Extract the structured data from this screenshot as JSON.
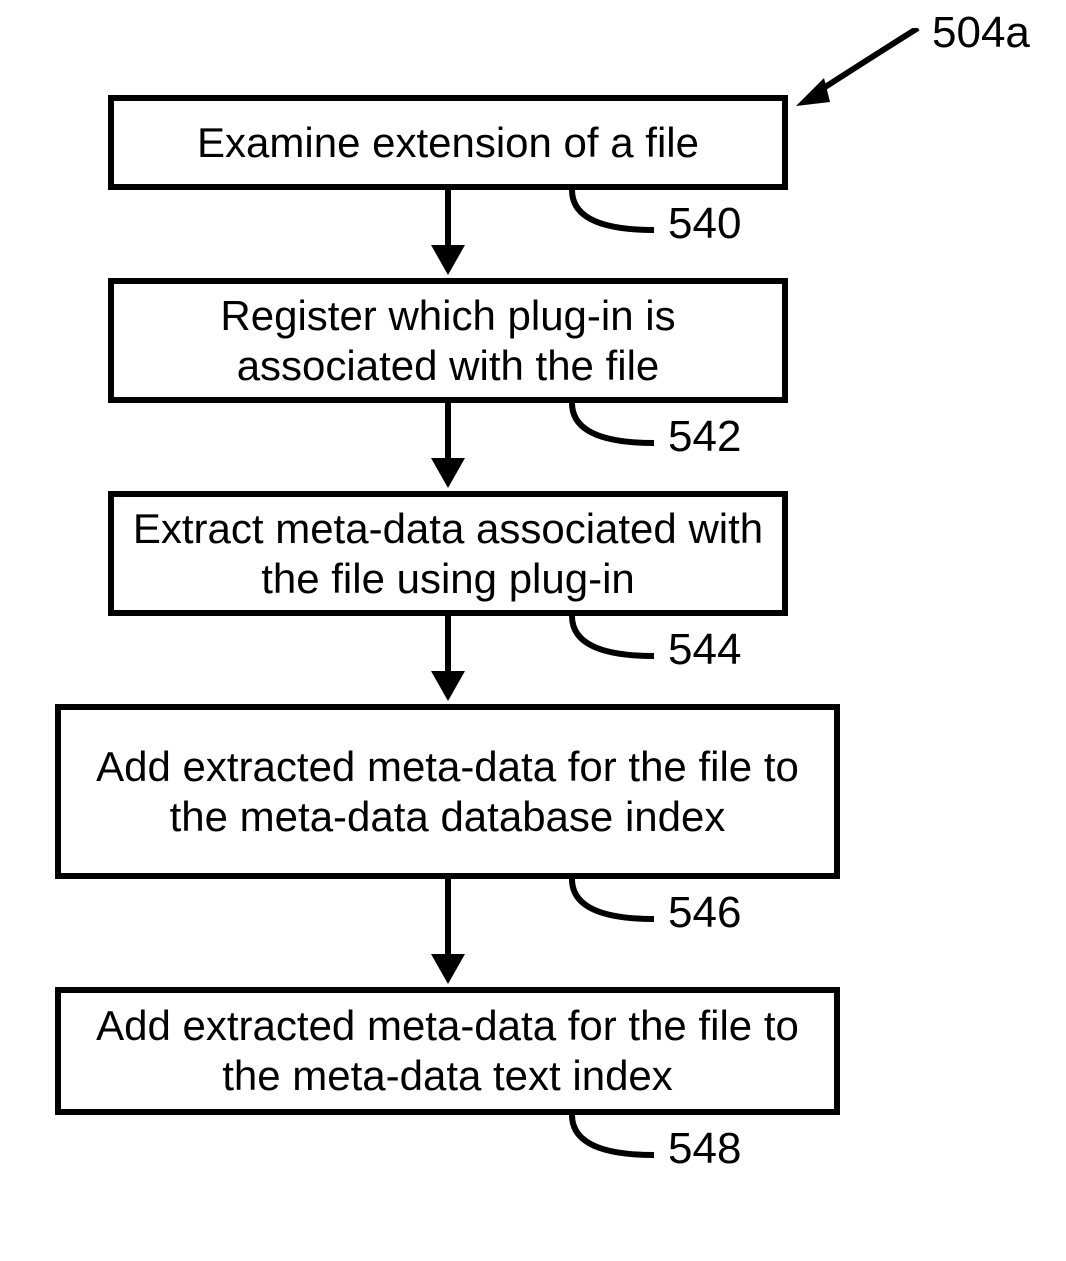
{
  "figure_label": "504a",
  "steps": [
    {
      "text": "Examine extension of a file",
      "num": "540"
    },
    {
      "text": "Register which plug-in is associated with the file",
      "num": "542"
    },
    {
      "text": "Extract meta-data associated with the file using plug-in",
      "num": "544"
    },
    {
      "text": "Add extracted meta-data for the file to the meta-data database index",
      "num": "546"
    },
    {
      "text": "Add extracted meta-data for the file to the meta-data text index",
      "num": "548"
    }
  ]
}
